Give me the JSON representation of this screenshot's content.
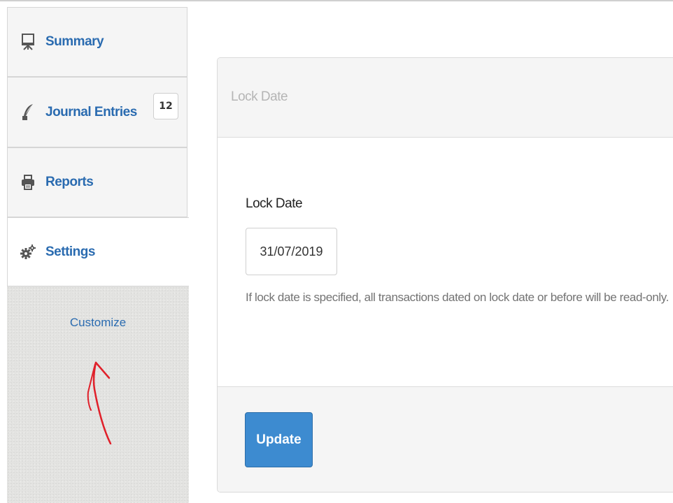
{
  "sidebar": {
    "items": [
      {
        "label": "Summary",
        "icon": "presentation-board-icon"
      },
      {
        "label": "Journal Entries",
        "icon": "quill-pen-icon",
        "count": "12"
      },
      {
        "label": "Reports",
        "icon": "printer-icon"
      },
      {
        "label": "Settings",
        "icon": "gears-icon",
        "active": true
      }
    ],
    "customize_label": "Customize"
  },
  "panel": {
    "title": "Lock Date",
    "field_label": "Lock Date",
    "lock_date_value": "31/07/2019",
    "help_text": "If lock date is specified, all transactions dated on lock date or before will be read-only.",
    "update_label": "Update"
  },
  "colors": {
    "link_blue": "#2a6bb0",
    "button_blue": "#3d8bd0",
    "annotation_red": "#e0202a"
  }
}
